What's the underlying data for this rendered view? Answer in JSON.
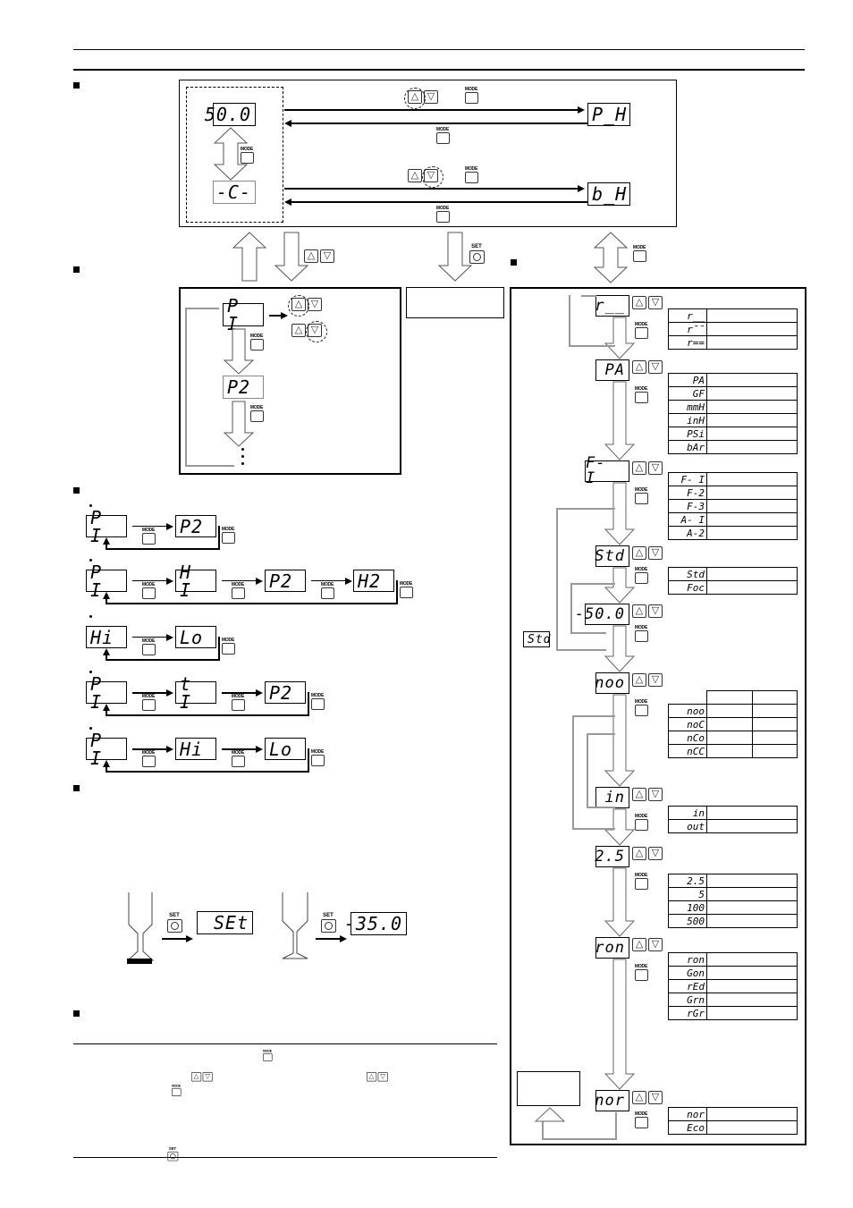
{
  "header": {
    "rule_top": true
  },
  "buttons": {
    "mode": "MODE",
    "set": "SET",
    "up": "△",
    "down": "▽"
  },
  "section1": {
    "displays": {
      "main": "50.0",
      "unit": "-C-",
      "peak": "P_H",
      "bottom": "b_H"
    }
  },
  "section2": {
    "displays": {
      "p1": "P I",
      "p2": "P2"
    }
  },
  "sidebox_empty": "",
  "section3": {
    "rows": [
      {
        "displays": [
          "P I",
          "P2"
        ]
      },
      {
        "displays": [
          "P I",
          "H I",
          "P2",
          "H2"
        ]
      },
      {
        "displays": [
          "Hi",
          "Lo"
        ]
      },
      {
        "displays": [
          "P I",
          "t I",
          "P2"
        ]
      },
      {
        "displays": [
          "P I",
          "Hi",
          "Lo"
        ]
      }
    ]
  },
  "section4": {
    "displays": {
      "set": "SEt",
      "value": "-35.0"
    }
  },
  "right_panel": {
    "steps": [
      {
        "display": "r__",
        "options": [
          "r__",
          "r¯¯",
          "r=="
        ]
      },
      {
        "display": "PA",
        "options": [
          "PA",
          "GF",
          "mmH",
          "inH",
          "PSi",
          "bAr"
        ]
      },
      {
        "display": "F- I",
        "options": [
          "F- I",
          "F-2",
          "F-3",
          "A- I",
          "A-2"
        ]
      },
      {
        "display": "Std",
        "options": [
          "Std",
          "Foc"
        ]
      },
      {
        "display": "-50.0",
        "options": []
      },
      {
        "display": "noo",
        "options": [
          "noo",
          "noC",
          "nCo",
          "nCC"
        ]
      },
      {
        "display": "in",
        "options": [
          "in",
          "out"
        ]
      },
      {
        "display": "2.5",
        "options": [
          "2.5",
          "5",
          "100",
          "500"
        ]
      },
      {
        "display": "ron",
        "options": [
          "ron",
          "Gon",
          "rEd",
          "Grn",
          "rGr"
        ]
      },
      {
        "display": "nor",
        "options": [
          "nor",
          "Eco"
        ]
      }
    ],
    "side_label": "Std"
  }
}
